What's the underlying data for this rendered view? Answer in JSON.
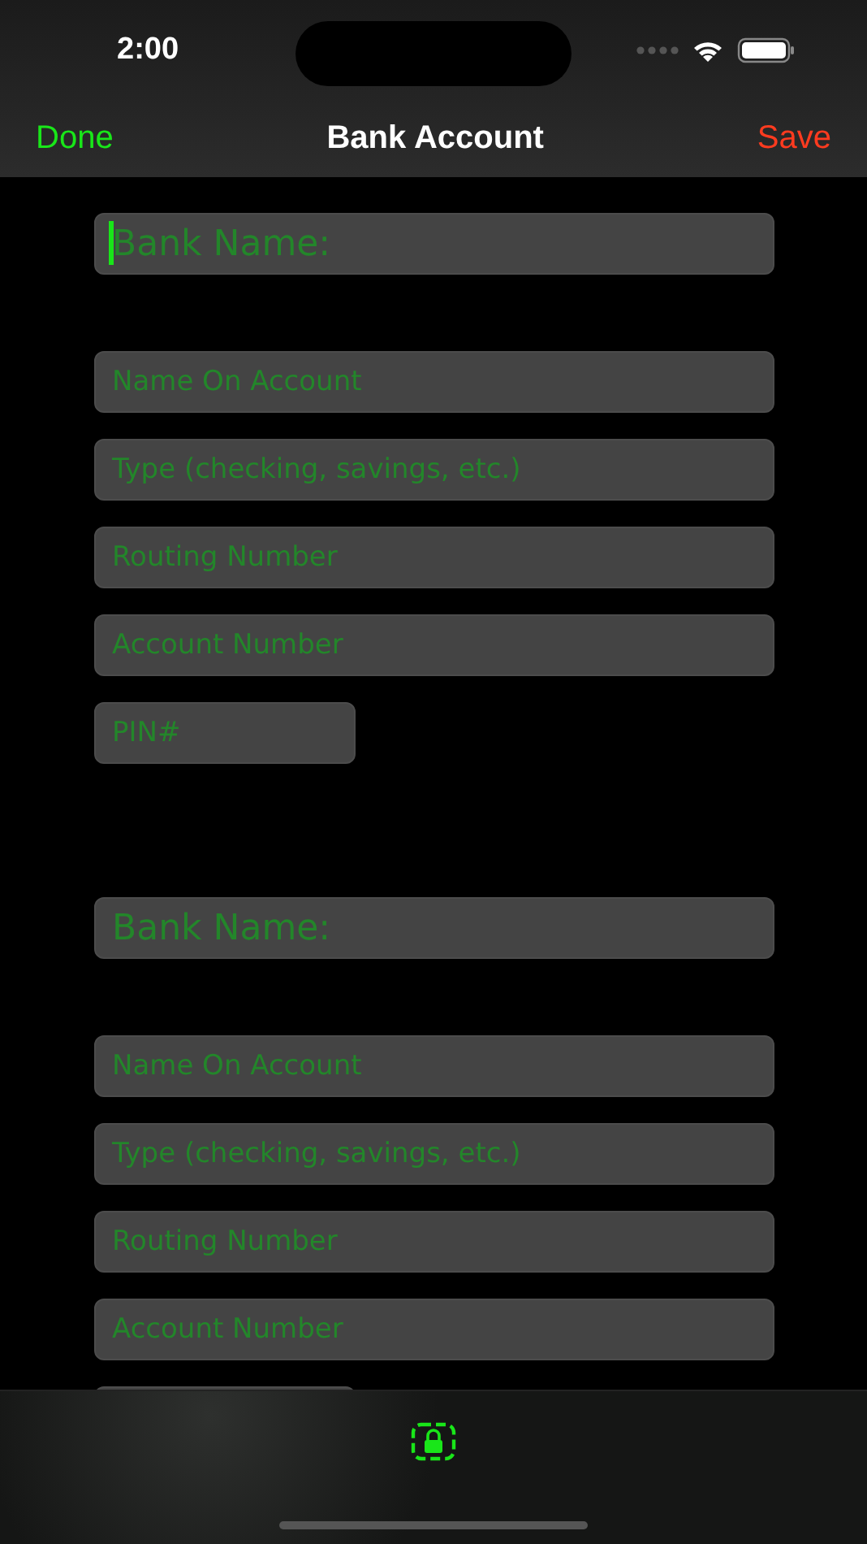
{
  "status_bar": {
    "time": "2:00"
  },
  "nav": {
    "left": "Done",
    "title": "Bank Account",
    "right": "Save"
  },
  "accounts": [
    {
      "fields": [
        {
          "kind": "bank",
          "placeholder": "Bank Name:",
          "focused": true
        },
        {
          "kind": "text",
          "placeholder": "Name On Account",
          "focused": false
        },
        {
          "kind": "text",
          "placeholder": "Type (checking, savings, etc.)",
          "focused": false
        },
        {
          "kind": "text",
          "placeholder": "Routing Number",
          "focused": false
        },
        {
          "kind": "text",
          "placeholder": "Account Number",
          "focused": false
        },
        {
          "kind": "pin",
          "placeholder": "PIN#",
          "focused": false
        }
      ]
    },
    {
      "fields": [
        {
          "kind": "bank",
          "placeholder": "Bank Name:",
          "focused": false
        },
        {
          "kind": "text",
          "placeholder": "Name On Account",
          "focused": false
        },
        {
          "kind": "text",
          "placeholder": "Type (checking, savings, etc.)",
          "focused": false
        },
        {
          "kind": "text",
          "placeholder": "Routing Number",
          "focused": false
        },
        {
          "kind": "text",
          "placeholder": "Account Number",
          "focused": false
        },
        {
          "kind": "pin"
        }
      ]
    }
  ]
}
